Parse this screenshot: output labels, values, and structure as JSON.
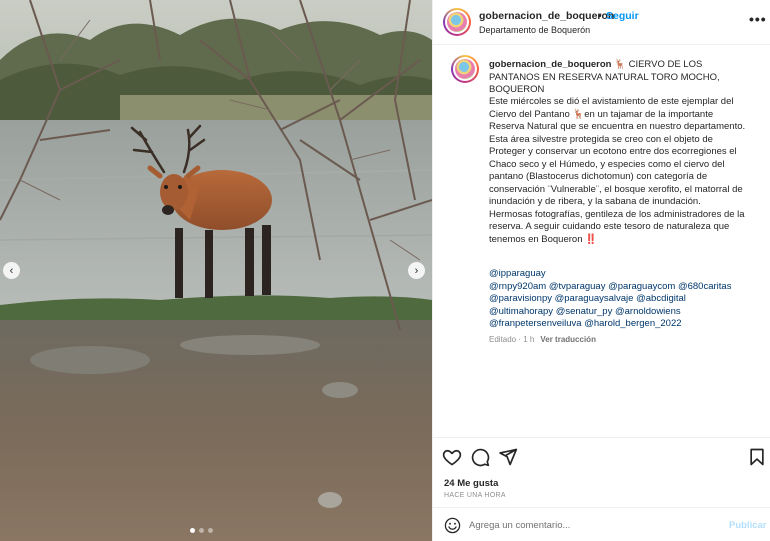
{
  "header": {
    "username": "gobernacion_de_boqueron",
    "separator": "•",
    "follow_label": "Seguir",
    "location": "Departamento de Boquerón",
    "more_glyph": "•••"
  },
  "caption": {
    "username": "gobernacion_de_boqueron",
    "title": "🦌 CIERVO DE LOS PANTANOS EN RESERVA NATURAL TORO MOCHO, BOQUERON",
    "body": "Este miércoles se dió el avistamiento de este ejemplar del Ciervo del Pantano 🦌en un tajamar de la importante Reserva Natural que se encuentra en nuestro departamento.\nEsta área silvestre protegida se creo con el objeto de Proteger y conservar un ecotono entre dos ecorregiones el Chaco seco y el Húmedo, y especies como el ciervo del pantano (Blastocerus dichotomun) con categoría de conservación ¨Vulnerable¨, el bosque xerofito, el matorral de inundación y de ribera, y la sabana de inundación.\nHermosas fotografías, gentileza de los administradores de la reserva. A seguir cuidando este tesoro de naturaleza que tenemos en Boqueron ‼️",
    "tags": [
      [
        "@ipparaguay"
      ],
      [
        "@rnpy920am",
        "@tvparaguay",
        "@paraguaycom",
        "@680caritas"
      ],
      [
        "@paravisionpy",
        "@paraguaysalvaje",
        "@abcdigital"
      ],
      [
        "@ultimahorapy",
        "@senatur_py",
        "@arnoldowiens"
      ],
      [
        "@franpetersenveiluva",
        "@harold_bergen_2022"
      ]
    ],
    "edited": "Editado · 1 h",
    "translate_label": "Ver traducción"
  },
  "actions": {
    "likes": "24 Me gusta",
    "time": "HACE UNA HORA",
    "icons": [
      "heart-icon",
      "comment-icon",
      "share-icon",
      "bookmark-icon"
    ]
  },
  "comment": {
    "placeholder": "Agrega un comentario...",
    "publish_label": "Publicar"
  },
  "carousel": {
    "prev_glyph": "‹",
    "next_glyph": "›",
    "slide_count": 3,
    "active_slide": 1
  },
  "colors": {
    "accent": "#0095f6",
    "link": "#00376b",
    "publish_disabled": "#b3dffc"
  }
}
